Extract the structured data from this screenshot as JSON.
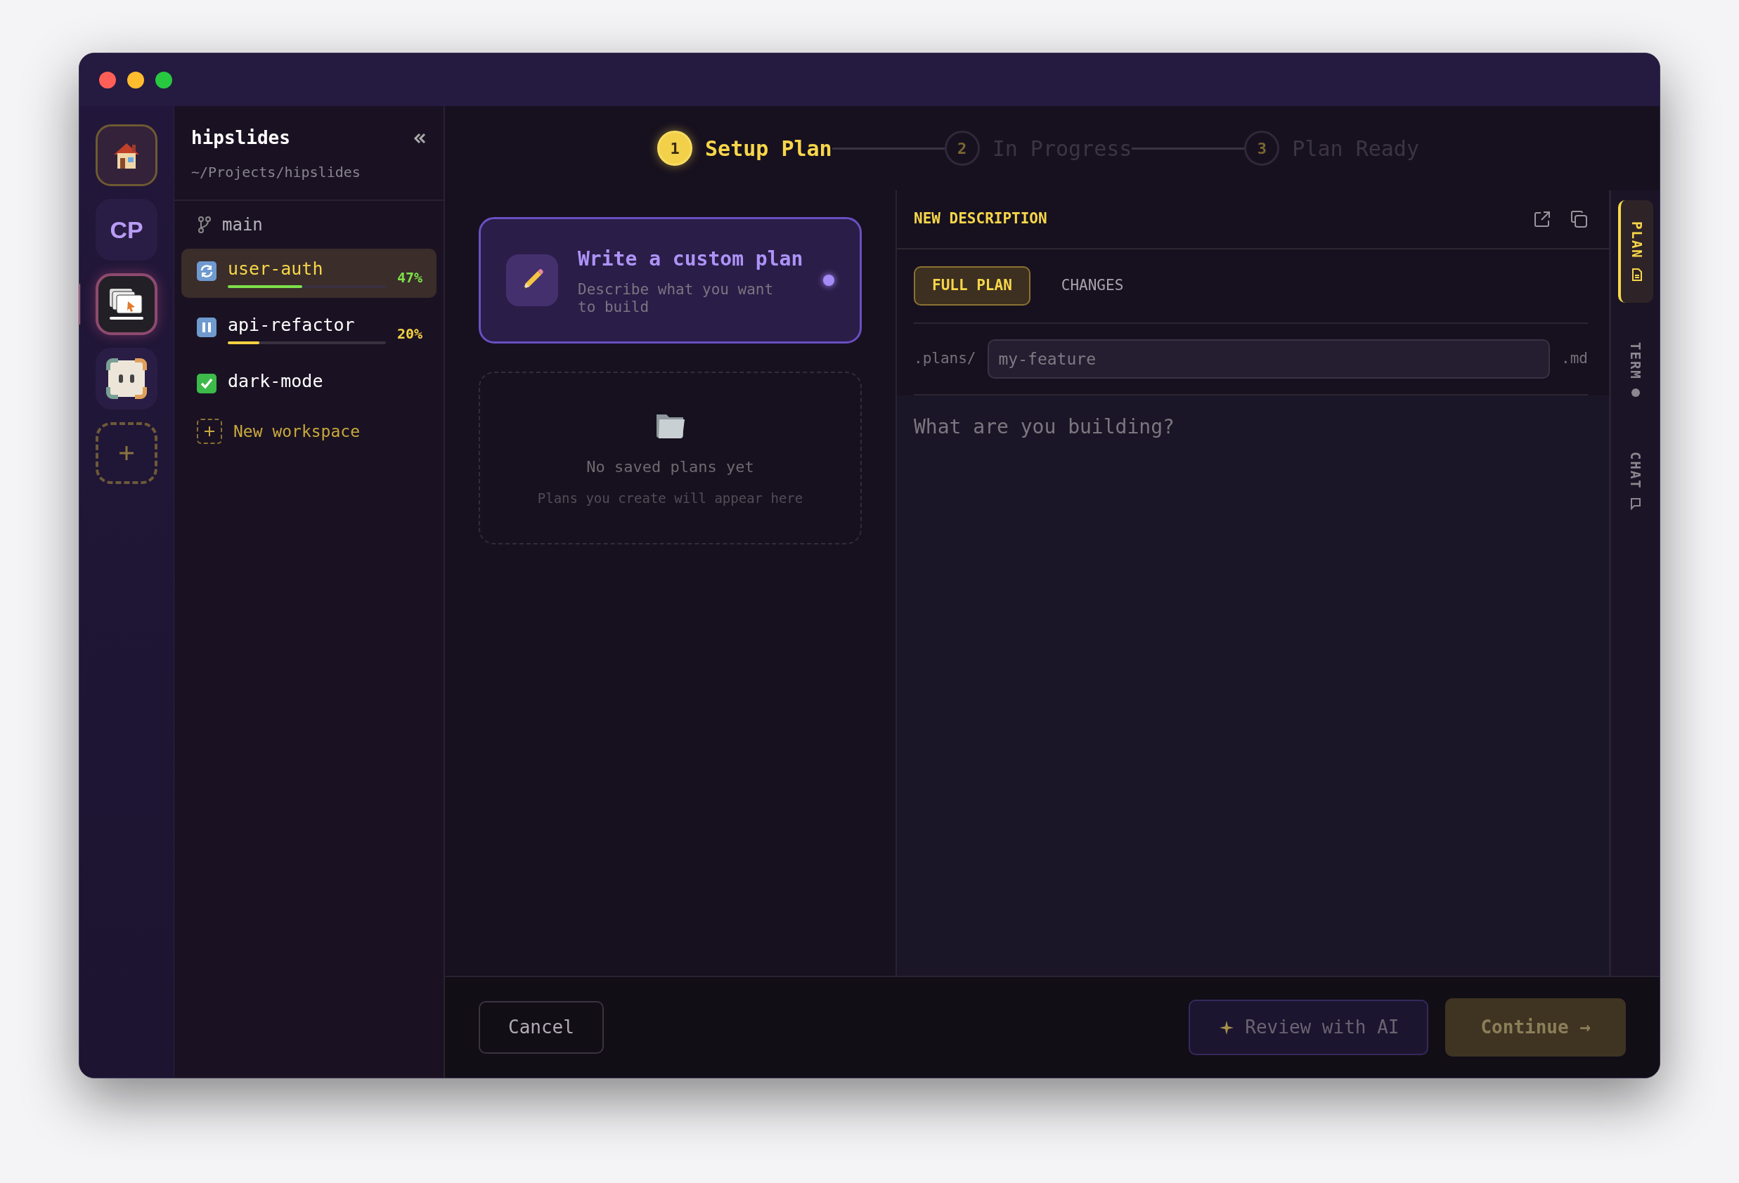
{
  "rail": {
    "items": [
      {
        "kind": "home",
        "selected": false
      },
      {
        "kind": "initials",
        "label": "CP",
        "selected": false
      },
      {
        "kind": "app",
        "selected": true
      },
      {
        "kind": "mascot",
        "selected": false
      },
      {
        "kind": "add",
        "selected": false
      }
    ]
  },
  "sidebar": {
    "title": "hipslides",
    "path": "~/Projects/hipslides",
    "branch": "main",
    "workspaces": [
      {
        "name": "user-auth",
        "kind": "running",
        "selected": true,
        "level": 0.47,
        "percent": "47%",
        "color": "#7ee04a"
      },
      {
        "name": "api-refactor",
        "kind": "paused",
        "selected": false,
        "level": 0.2,
        "percent": "20%",
        "color": "#f5d142"
      },
      {
        "name": "dark-mode",
        "kind": "done",
        "selected": false
      }
    ],
    "new_workspace": "New workspace"
  },
  "stepper": {
    "steps": [
      {
        "number": "1",
        "label": "Setup Plan",
        "selected": true
      },
      {
        "number": "2",
        "label": "In Progress",
        "selected": false
      },
      {
        "number": "3",
        "label": "Plan Ready",
        "selected": false
      }
    ]
  },
  "plan_card": {
    "title": "Write a custom plan",
    "subtitle": "Describe what you want to build",
    "selected": true
  },
  "empty_state": {
    "title": "No saved plans yet",
    "text": "Plans you create will appear here"
  },
  "editor": {
    "title": "NEW DESCRIPTION",
    "tabs": [
      {
        "label": "FULL PLAN",
        "selected": true
      },
      {
        "label": "CHANGES",
        "selected": false
      }
    ],
    "prefix": ".plans/",
    "filename": {
      "placeholder": "my-feature"
    },
    "suffix": ".md",
    "body": {
      "placeholder": "What are you building?"
    }
  },
  "side_tabs": [
    {
      "label": "PLAN",
      "kind": "document",
      "selected": true
    },
    {
      "label": "TERM",
      "kind": "dot",
      "selected": false
    },
    {
      "label": "CHAT",
      "kind": "chat",
      "selected": false
    }
  ],
  "footer": {
    "cancel": "Cancel",
    "review": {
      "label": "Review with AI",
      "disabled": true
    },
    "continue": {
      "label": "Continue →",
      "disabled": true
    }
  }
}
